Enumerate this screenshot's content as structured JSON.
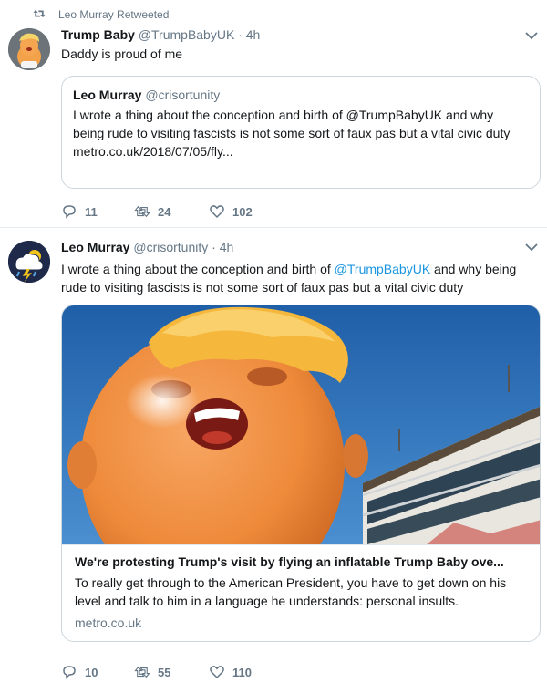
{
  "tweet1": {
    "retweet_label": "Leo Murray Retweeted",
    "display_name": "Trump Baby",
    "handle": "@TrumpBabyUK",
    "separator": "·",
    "time": "4h",
    "text": "Daddy is proud of me",
    "quote": {
      "display_name": "Leo Murray",
      "handle": "@crisortunity",
      "text": "I wrote a thing about the conception and birth of @TrumpBabyUK and why being rude to visiting fascists is not some sort of faux pas but a vital civic duty",
      "link": "metro.co.uk/2018/07/05/fly..."
    },
    "actions": {
      "replies": "11",
      "retweets": "24",
      "likes": "102"
    }
  },
  "tweet2": {
    "display_name": "Leo Murray",
    "handle": "@crisortunity",
    "separator": "·",
    "time": "4h",
    "text_before": "I wrote a thing about the conception and birth of ",
    "mention": "@TrumpBabyUK",
    "text_after": " and why being rude to visiting fascists is not some sort of faux pas but a vital civic duty",
    "card": {
      "title": "We're protesting Trump's visit by flying an inflatable Trump Baby ove...",
      "description": "To really get through to the American President, you have to get down on his level and talk to him in a language he understands: personal insults.",
      "domain": "metro.co.uk"
    },
    "actions": {
      "replies": "10",
      "retweets": "55",
      "likes": "110"
    }
  },
  "colors": {
    "link": "#1b95e0",
    "secondary": "#657786",
    "border": "#ccd6dd"
  }
}
